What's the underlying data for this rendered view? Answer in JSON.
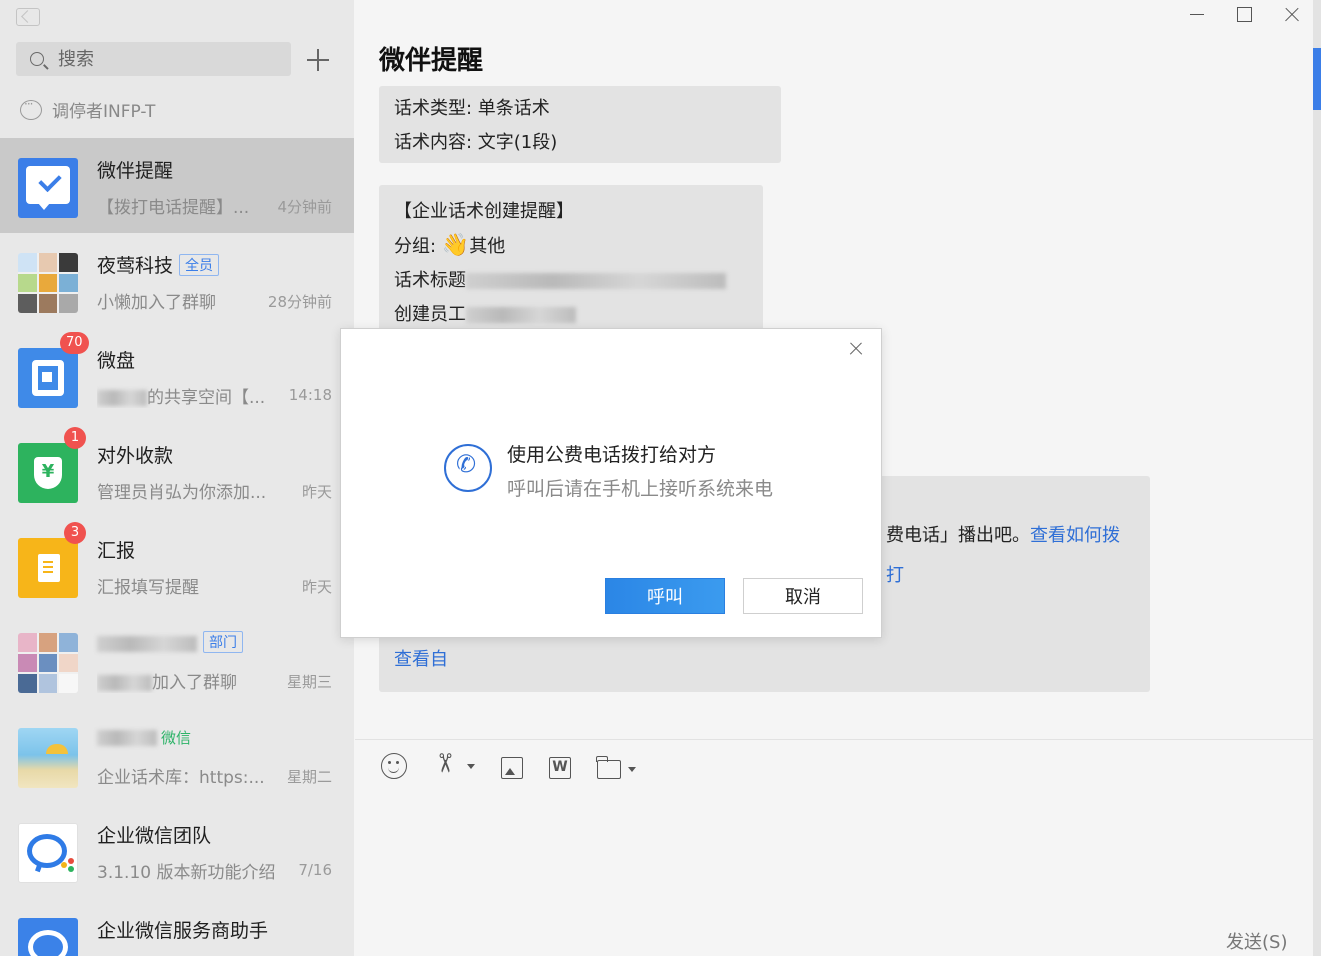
{
  "sidebar": {
    "search_placeholder": "搜索",
    "status": "调停者INFP-T",
    "conversations": [
      {
        "name": "微伴提醒",
        "tag": "",
        "preview": "【拨打电话提醒】...",
        "time": "4分钟前",
        "badge": ""
      },
      {
        "name": "夜莺科技",
        "tag": "全员",
        "preview": "小懒加入了群聊",
        "time": "28分钟前",
        "badge": ""
      },
      {
        "name": "微盘",
        "tag": "",
        "preview": "的共享空间【...",
        "time": "14:18",
        "badge": "70"
      },
      {
        "name": "对外收款",
        "tag": "",
        "preview": "管理员肖弘为你添加...",
        "time": "昨天",
        "badge": "1"
      },
      {
        "name": "汇报",
        "tag": "",
        "preview": "汇报填写提醒",
        "time": "昨天",
        "badge": "3"
      },
      {
        "name": "",
        "tag": "部门",
        "preview": "加入了群聊",
        "time": "星期三",
        "badge": ""
      },
      {
        "name": "",
        "tag": "微信",
        "preview": "企业话术库：https:...",
        "time": "星期二",
        "badge": ""
      },
      {
        "name": "企业微信团队",
        "tag": "",
        "preview": "3.1.10 版本新功能介绍",
        "time": "7/16",
        "badge": ""
      },
      {
        "name": "企业微信服务商助手",
        "tag": "",
        "preview": "",
        "time": "",
        "badge": ""
      }
    ]
  },
  "chat": {
    "title": "微伴提醒",
    "card1": {
      "line1": "话术类型: 单条话术",
      "line2": "话术内容: 文字(1段)"
    },
    "card2": {
      "line1": "【企业话术创建提醒】",
      "group_prefix": "分组: ",
      "group_value": "其他",
      "line3": "话术标题",
      "line4": "创建员工"
    },
    "card3": {
      "text": "费电话」播出吧。",
      "link": "查看如何拨打",
      "link2": "查看自"
    },
    "send_label": "发送(S)"
  },
  "modal": {
    "title": "使用公费电话拨打给对方",
    "subtitle": "呼叫后请在手机上接听系统来电",
    "call_label": "呼叫",
    "cancel_label": "取消"
  },
  "colors": {
    "accent": "#3b7ee8",
    "badge": "#f0524f",
    "link": "#2f6fd6"
  }
}
